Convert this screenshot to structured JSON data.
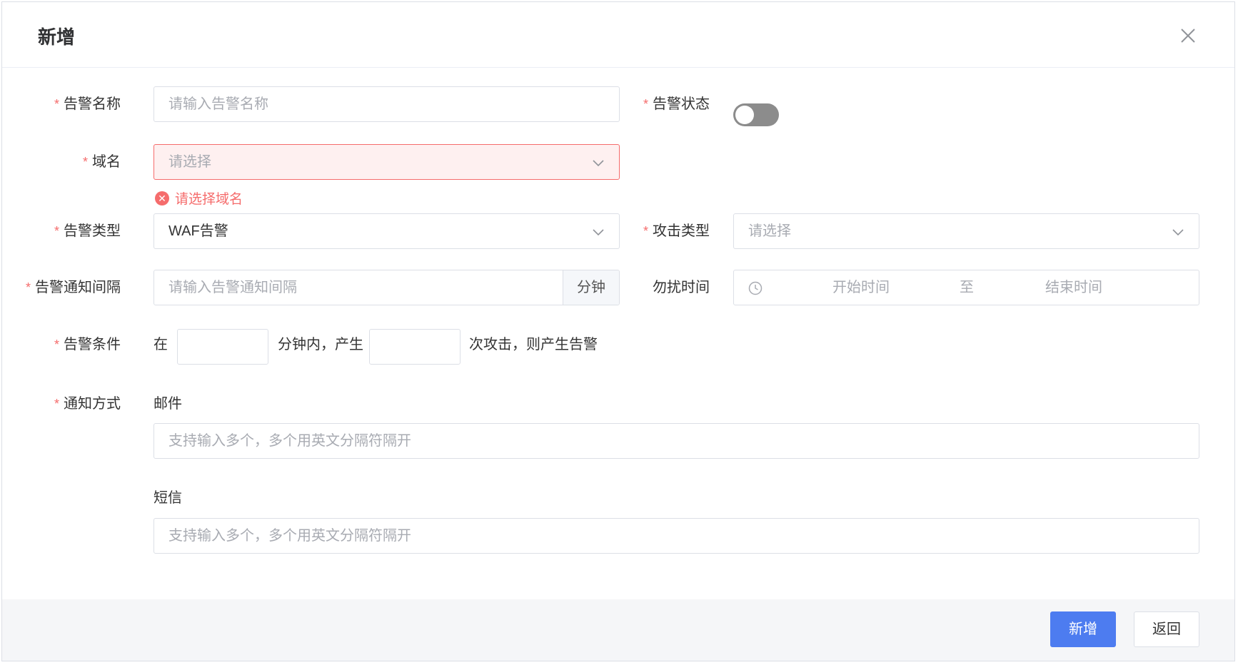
{
  "dialog": {
    "title": "新增",
    "close_icon": "close-icon"
  },
  "form": {
    "required_mark": "*",
    "alarm_name": {
      "label": "告警名称",
      "placeholder": "请输入告警名称",
      "value": ""
    },
    "alarm_status": {
      "label": "告警状态",
      "enabled": false
    },
    "domain": {
      "label": "域名",
      "placeholder": "请选择",
      "error": "请选择域名"
    },
    "alarm_type": {
      "label": "告警类型",
      "value": "WAF告警"
    },
    "attack_type": {
      "label": "攻击类型",
      "placeholder": "请选择"
    },
    "notify_interval": {
      "label": "告警通知间隔",
      "placeholder": "请输入告警通知间隔",
      "unit": "分钟"
    },
    "quiet_time": {
      "label": "勿扰时间",
      "start_placeholder": "开始时间",
      "separator": "至",
      "end_placeholder": "结束时间"
    },
    "condition": {
      "label": "告警条件",
      "prefix": "在",
      "middle": "分钟内，产生",
      "suffix": "次攻击，则产生告警",
      "minutes": "",
      "count": ""
    },
    "notify_method": {
      "label": "通知方式",
      "email": {
        "title": "邮件",
        "placeholder": "支持输入多个，多个用英文分隔符隔开"
      },
      "sms": {
        "title": "短信",
        "placeholder": "支持输入多个，多个用英文分隔符隔开"
      }
    }
  },
  "footer": {
    "submit_label": "新增",
    "back_label": "返回"
  },
  "colors": {
    "primary": "#4d7cf0",
    "error": "#f56c6c",
    "toggle_off": "#8c8c8c"
  }
}
